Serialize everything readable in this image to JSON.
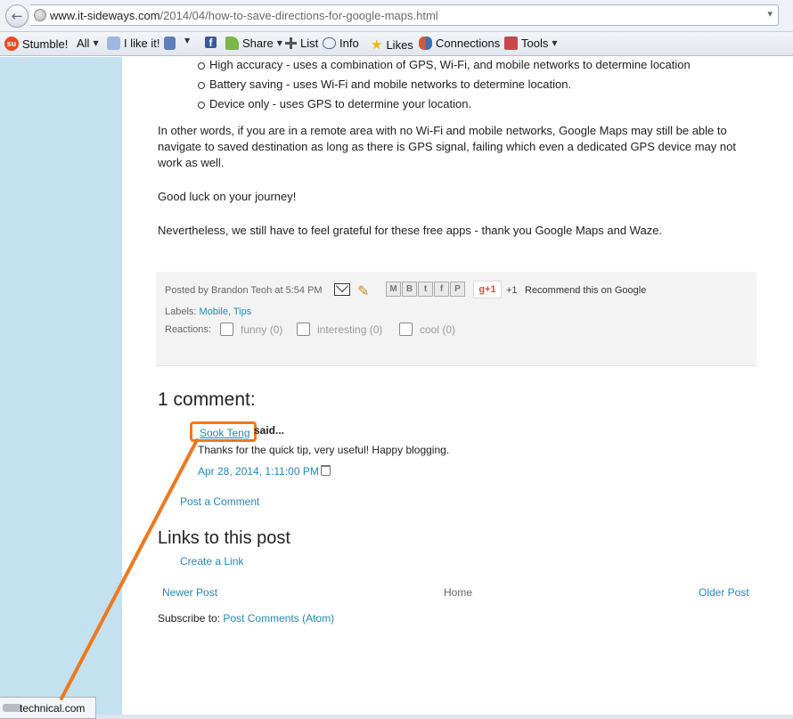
{
  "browser": {
    "url_domain": "www.it-sideways.com",
    "url_path": "/2014/04/how-to-save-directions-for-google-maps.html",
    "back_glyph": "←",
    "dropdown_glyph": "▾"
  },
  "toolbar": {
    "stumble": "Stumble!",
    "all": "All",
    "i_like_it": "I like it!",
    "share": "Share",
    "list": "List",
    "info": "Info",
    "likes": "Likes",
    "connections": "Connections",
    "tools": "Tools"
  },
  "article": {
    "bullets": [
      "High accuracy - uses a combination of GPS, Wi-Fi, and mobile networks to determine location",
      "Battery saving - uses Wi-Fi and mobile networks to determine location.",
      "Device only - uses GPS to determine your location."
    ],
    "para_remote": "In other words, if you are in a remote area with no Wi-Fi and mobile networks, Google Maps may still be able to navigate to saved destination as long as there is GPS signal, failing which even a dedicated GPS device may not work as well.",
    "para_luck": "Good luck on your journey!",
    "para_grateful": "Nevertheless, we still have to feel grateful for these free apps - thank you Google Maps and Waze."
  },
  "post_footer": {
    "posted_by_label": "Posted by",
    "author": "Brandon Teoh",
    "at_label": "at",
    "time": "5:54 PM",
    "gplus_label": "g+1",
    "plusone_count": "+1",
    "recommend": "Recommend this on Google",
    "labels_label": "Labels:",
    "label_mobile": "Mobile",
    "label_separator": ",",
    "label_tips": "Tips",
    "reactions_label": "Reactions:",
    "reactions": [
      "funny (0)",
      "interesting (0)",
      "cool (0)"
    ]
  },
  "comments": {
    "title": "1 comment:",
    "author": "Sook Teng",
    "said": "said...",
    "body": "Thanks for the quick tip, very useful! Happy blogging.",
    "date": "Apr 28, 2014, 1:11:00 PM",
    "post_comment": "Post a Comment"
  },
  "links": {
    "title": "Links to this post",
    "create": "Create a Link"
  },
  "nav": {
    "newer": "Newer Post",
    "home": "Home",
    "older": "Older Post",
    "subscribe_label": "Subscribe to:",
    "subscribe_link": "Post Comments (Atom)"
  },
  "status": {
    "text": "technical.com"
  },
  "colors": {
    "annotation": "#f0781e",
    "link": "#2288bb",
    "margin": "#c3e1ee"
  }
}
